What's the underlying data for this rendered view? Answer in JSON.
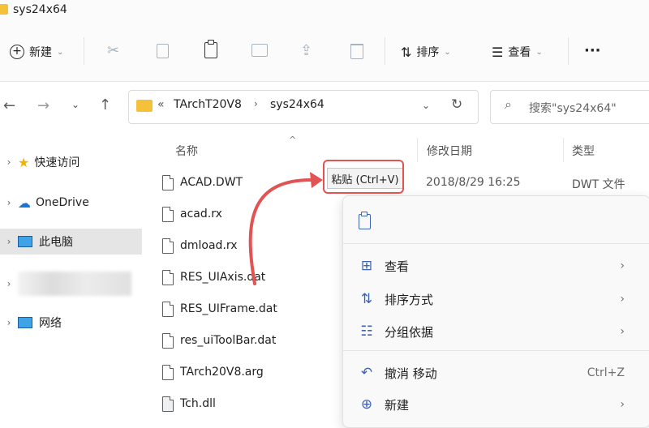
{
  "window": {
    "title": "sys24x64"
  },
  "toolbar": {
    "new_label": "新建",
    "sort_label": "排序",
    "view_label": "查看",
    "more_label": "···"
  },
  "address": {
    "overflow": "«",
    "crumbs": [
      "TArchT20V8",
      "sys24x64"
    ]
  },
  "search": {
    "placeholder": "搜索\"sys24x64\""
  },
  "sidebar": {
    "items": [
      {
        "label": "快速访问"
      },
      {
        "label": "OneDrive"
      },
      {
        "label": "此电脑"
      },
      {
        "label": ""
      },
      {
        "label": "网络"
      }
    ]
  },
  "columns": {
    "name": "名称",
    "modified": "修改日期",
    "type": "类型"
  },
  "files": [
    {
      "name": "ACAD.DWT",
      "modified": "2018/8/29 16:25",
      "type": "DWT 文件"
    },
    {
      "name": "acad.rx"
    },
    {
      "name": "dmload.rx"
    },
    {
      "name": "RES_UIAxis.dat"
    },
    {
      "name": "RES_UIFrame.dat"
    },
    {
      "name": "res_uiToolBar.dat"
    },
    {
      "name": "TArch20V8.arg"
    },
    {
      "name": "Tch.dll"
    }
  ],
  "tooltip": {
    "label": "粘贴 (Ctrl+V)"
  },
  "context_menu": {
    "items": [
      {
        "label": "查看",
        "icon": "grid-icon",
        "submenu": true
      },
      {
        "label": "排序方式",
        "icon": "sort-icon",
        "submenu": true
      },
      {
        "label": "分组依据",
        "icon": "group-icon",
        "submenu": true
      },
      {
        "label": "撤消 移动",
        "icon": "undo-icon",
        "shortcut": "Ctrl+Z"
      },
      {
        "label": "新建",
        "icon": "plus-circle-icon",
        "submenu": true
      }
    ]
  },
  "colors": {
    "accent": "#3c63b4",
    "annotation": "#e25353",
    "folder": "#f3c23a"
  }
}
